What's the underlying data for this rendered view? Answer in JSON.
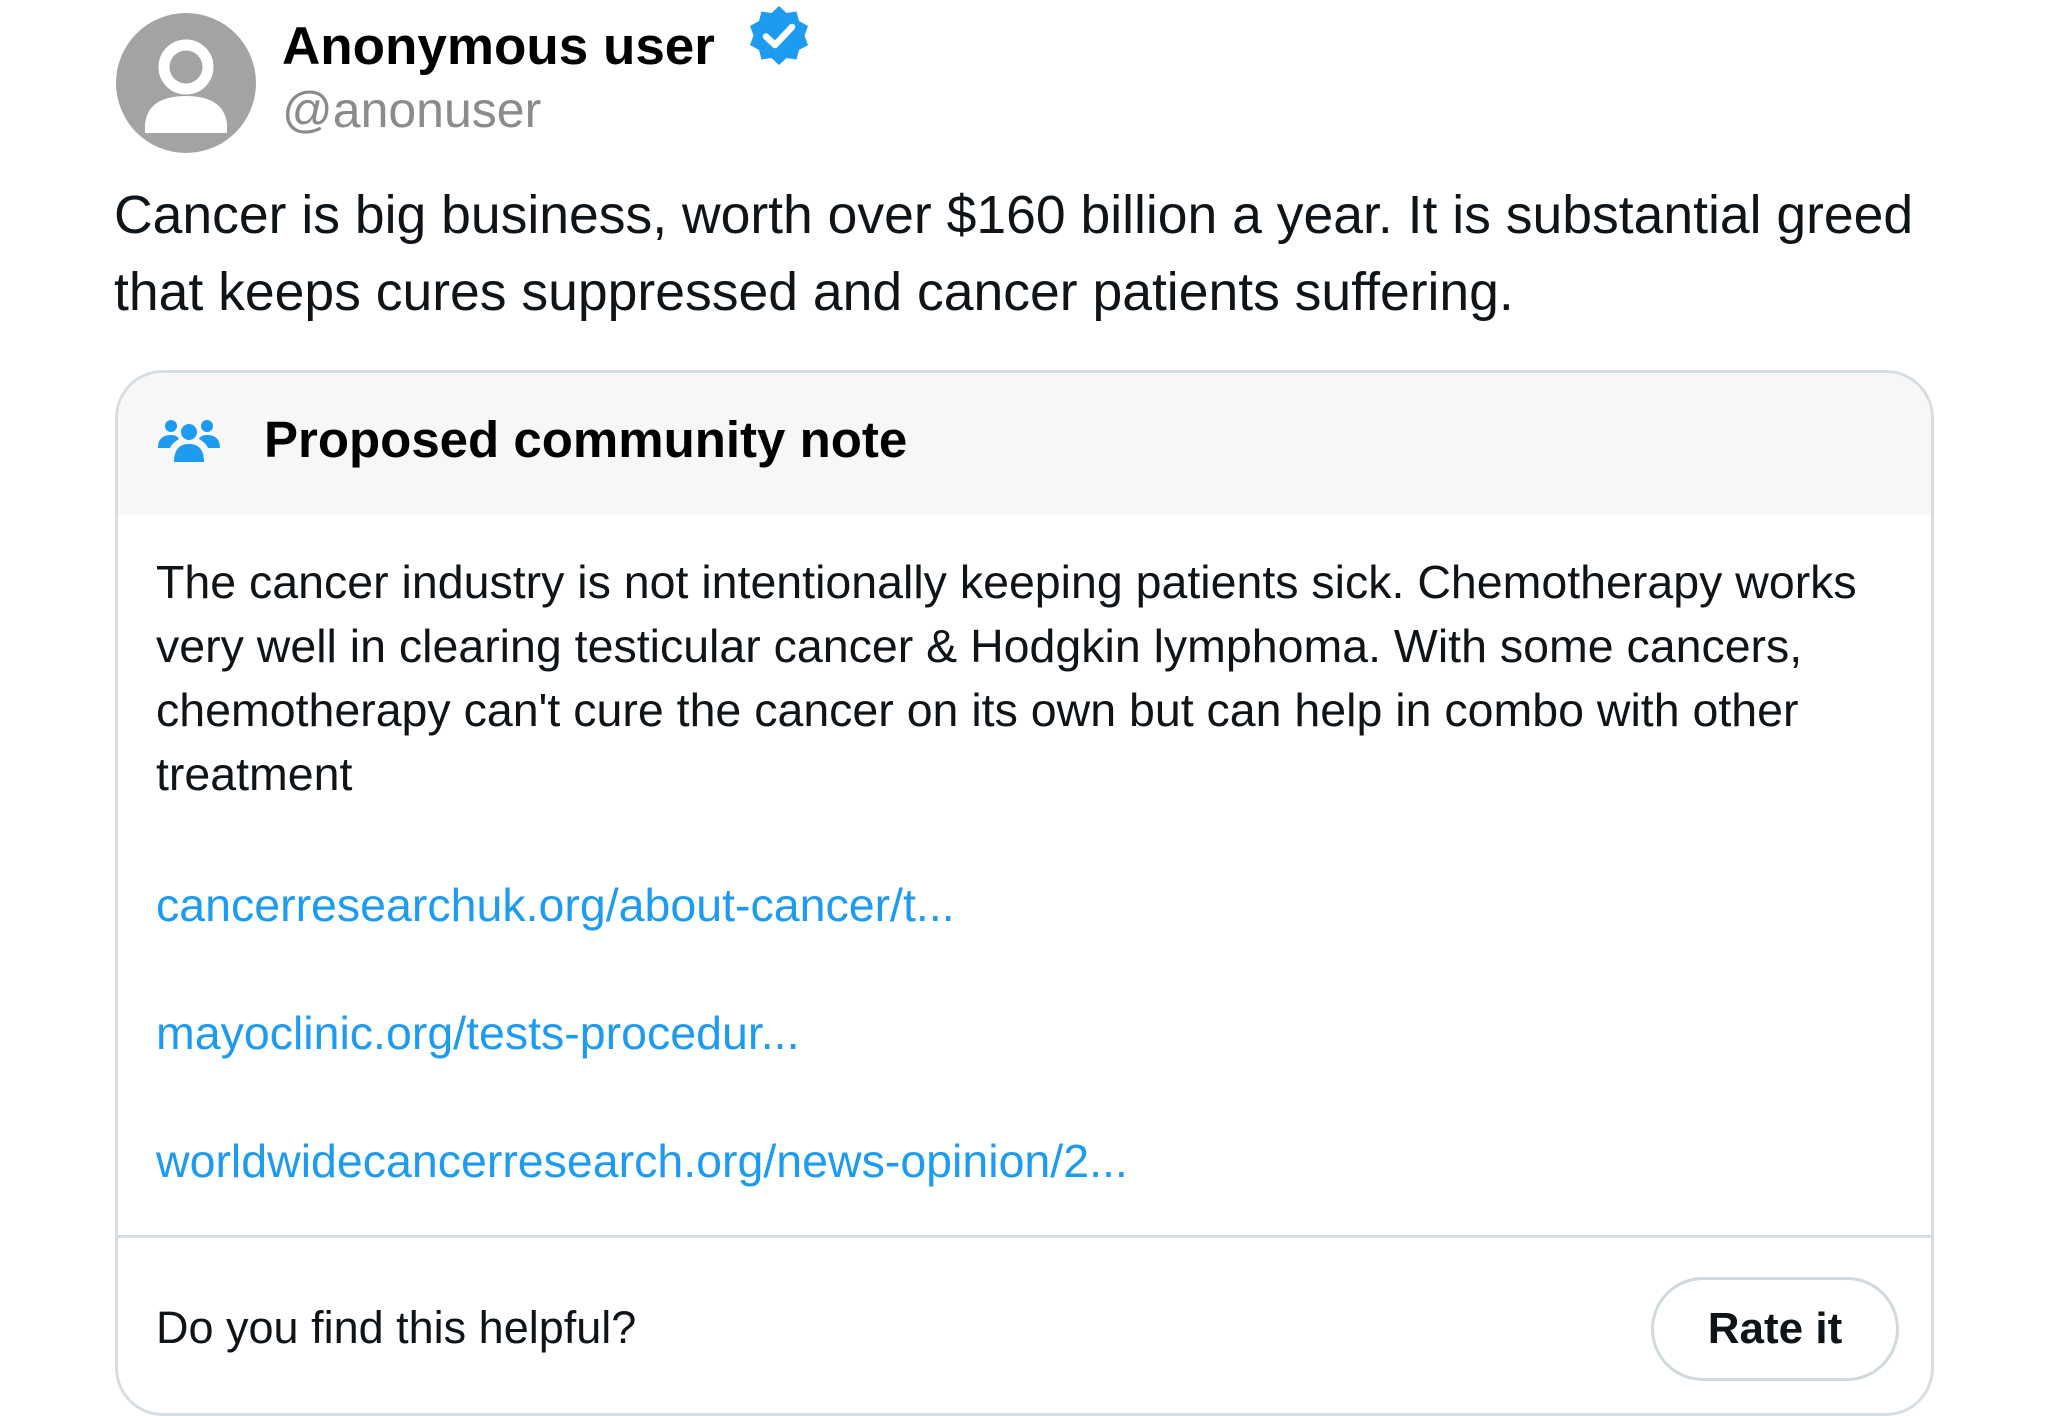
{
  "post": {
    "author": {
      "display_name": "Anonymous user",
      "handle": "@anonuser",
      "verified": true,
      "avatar_icon": "default-user-avatar-icon",
      "verified_icon": "verified-badge-icon"
    },
    "text": "Cancer is big business, worth over $160 billion a year. It is substantial greed that keeps cures suppressed and cancer patients suffering."
  },
  "community_note": {
    "header_icon": "people-icon",
    "title": "Proposed community note",
    "body": "The cancer industry is not intentionally keeping patients sick. Chemotherapy works very well in clearing testicular cancer & Hodgkin lymphoma. With some cancers, chemotherapy can't cure the cancer on its own but can help in combo with other treatment",
    "links": [
      "cancerresearchuk.org/about-cancer/t...",
      "mayoclinic.org/tests-procedur...",
      "worldwidecancerresearch.org/news-opinion/2..."
    ],
    "helpful_question": "Do you find this helpful?",
    "rate_button_label": "Rate it"
  },
  "colors": {
    "link": "#1d9bf0",
    "verified_badge": "#1d9bf0",
    "avatar_background": "#a3a3a3",
    "handle_text": "#8b8b8b",
    "card_border": "#d6dde3",
    "header_background": "#f7f7f7"
  }
}
